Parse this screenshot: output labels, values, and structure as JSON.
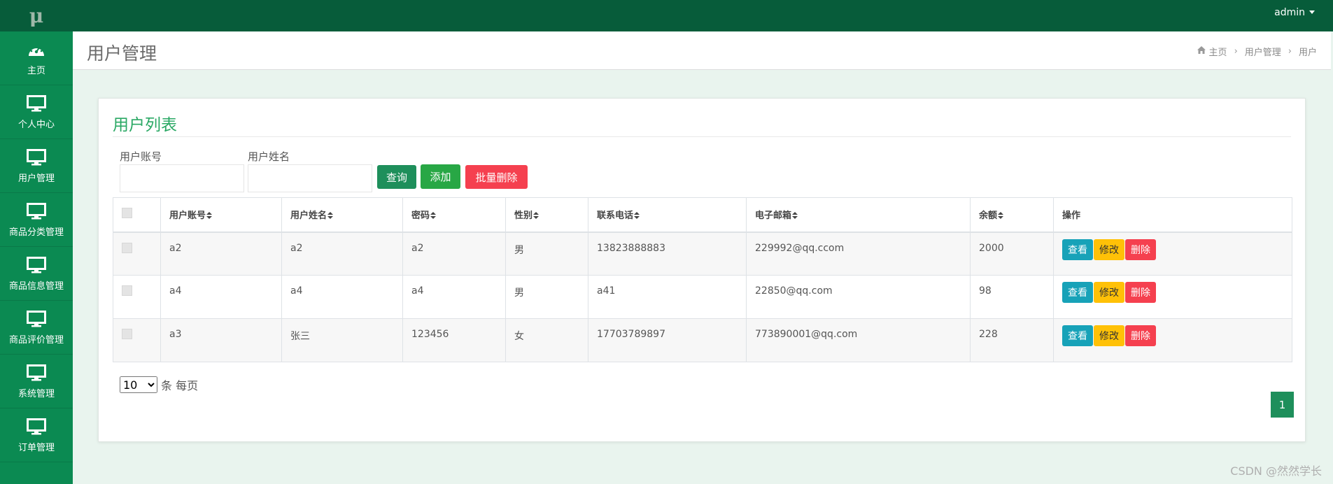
{
  "brand": {
    "logo": "μ"
  },
  "sidebar": {
    "items": [
      {
        "label": "主页",
        "icon": "dashboard-icon"
      },
      {
        "label": "个人中心",
        "icon": "monitor-icon"
      },
      {
        "label": "用户管理",
        "icon": "monitor-icon"
      },
      {
        "label": "商品分类管理",
        "icon": "monitor-icon"
      },
      {
        "label": "商品信息管理",
        "icon": "monitor-icon"
      },
      {
        "label": "商品评价管理",
        "icon": "monitor-icon"
      },
      {
        "label": "系统管理",
        "icon": "monitor-icon"
      },
      {
        "label": "订单管理",
        "icon": "monitor-icon"
      }
    ]
  },
  "topbar": {
    "user": "admin"
  },
  "header": {
    "title": "用户管理",
    "breadcrumb": [
      "主页",
      "用户管理",
      "用户"
    ]
  },
  "card": {
    "title": "用户列表"
  },
  "search": {
    "account_label": "用户账号",
    "name_label": "用户姓名",
    "query_button": "查询",
    "add_button": "添加",
    "batch_delete_button": "批量删除"
  },
  "table": {
    "columns": [
      "用户账号",
      "用户姓名",
      "密码",
      "性别",
      "联系电话",
      "电子邮箱",
      "余额",
      "操作"
    ],
    "rows": [
      {
        "account": "a2",
        "name": "a2",
        "password": "a2",
        "gender": "男",
        "phone": "13823888883",
        "email": "229992@qq.ccom",
        "balance": "2000"
      },
      {
        "account": "a4",
        "name": "a4",
        "password": "a4",
        "gender": "男",
        "phone": "a41",
        "email": "22850@qq.com",
        "balance": "98"
      },
      {
        "account": "a3",
        "name": "张三",
        "password": "123456",
        "gender": "女",
        "phone": "17703789897",
        "email": "773890001@qq.com",
        "balance": "228"
      }
    ],
    "actions": {
      "view": "查看",
      "edit": "修改",
      "delete": "删除"
    }
  },
  "pagination": {
    "page_size": "10",
    "per_page_label": "条 每页",
    "current_page": "1"
  },
  "watermark": "CSDN @然然学长",
  "colors": {
    "sidebar": "#0b8a52",
    "topbar": "#075c3a",
    "accent": "#2aa864",
    "view": "#17a2b8",
    "edit": "#ffc107",
    "delete": "#f5404f"
  }
}
